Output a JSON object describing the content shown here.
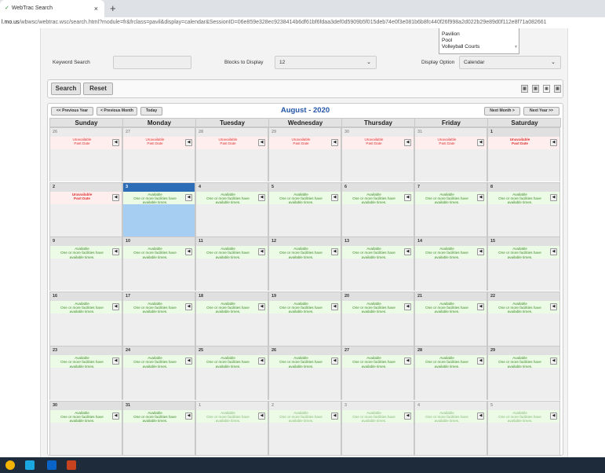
{
  "browser": {
    "tab_title": "WebTrac Search",
    "tab_close": "×",
    "new_tab": "+",
    "url_host": "l.mo.us",
    "url_rest": "/wbwsc/webtrac.wsc/search.html?module=fr&frclass=pavil&display=calendar&SessionID=06e859e328ec9238414b6df61bf6fdaa3def0d5909b5f015deb74e0f3e081b6b8fc440f26f998a2d022b29e89d0f112e8f71a082661"
  },
  "facilities": [
    "Pavilion",
    "Pool",
    "Volleyball Courts"
  ],
  "filters": {
    "keyword_label": "Keyword Search",
    "keyword_value": "",
    "blocks_label": "Blocks to Display",
    "blocks_value": "12",
    "display_label": "Display Option",
    "display_value": "Calendar"
  },
  "buttons": {
    "search": "Search",
    "reset": "Reset"
  },
  "calendar": {
    "prev_year": "<< Previous Year",
    "prev_month": "< Previous Month",
    "today": "Today",
    "title": "August - 2020",
    "next_month": "Next Month >",
    "next_year": "Next Year >>",
    "days": [
      "Sunday",
      "Monday",
      "Tuesday",
      "Wednesday",
      "Thursday",
      "Friday",
      "Saturday"
    ],
    "unavailable_line1": "Unavailable",
    "unavailable_line2": "Past Date",
    "available_line1": "Available",
    "available_line2": "One or more facilities have",
    "available_line3": "available times.",
    "weeks": [
      [
        {
          "d": "26",
          "s": "unav",
          "o": true
        },
        {
          "d": "27",
          "s": "unav",
          "o": true
        },
        {
          "d": "28",
          "s": "unav",
          "o": true
        },
        {
          "d": "29",
          "s": "unav",
          "o": true
        },
        {
          "d": "30",
          "s": "unav",
          "o": true
        },
        {
          "d": "31",
          "s": "unav",
          "o": true
        },
        {
          "d": "1",
          "s": "unav",
          "o": false,
          "b": true
        }
      ],
      [
        {
          "d": "2",
          "s": "unav",
          "o": false,
          "b": true
        },
        {
          "d": "3",
          "s": "av",
          "o": false,
          "t": true
        },
        {
          "d": "4",
          "s": "av",
          "o": false
        },
        {
          "d": "5",
          "s": "av",
          "o": false
        },
        {
          "d": "6",
          "s": "av",
          "o": false
        },
        {
          "d": "7",
          "s": "av",
          "o": false
        },
        {
          "d": "8",
          "s": "av",
          "o": false
        }
      ],
      [
        {
          "d": "9",
          "s": "av",
          "o": false
        },
        {
          "d": "10",
          "s": "av",
          "o": false
        },
        {
          "d": "11",
          "s": "av",
          "o": false
        },
        {
          "d": "12",
          "s": "av",
          "o": false
        },
        {
          "d": "13",
          "s": "av",
          "o": false
        },
        {
          "d": "14",
          "s": "av",
          "o": false
        },
        {
          "d": "15",
          "s": "av",
          "o": false
        }
      ],
      [
        {
          "d": "16",
          "s": "av",
          "o": false
        },
        {
          "d": "17",
          "s": "av",
          "o": false
        },
        {
          "d": "18",
          "s": "av",
          "o": false
        },
        {
          "d": "19",
          "s": "av",
          "o": false
        },
        {
          "d": "20",
          "s": "av",
          "o": false
        },
        {
          "d": "21",
          "s": "av",
          "o": false
        },
        {
          "d": "22",
          "s": "av",
          "o": false
        }
      ],
      [
        {
          "d": "23",
          "s": "av",
          "o": false
        },
        {
          "d": "24",
          "s": "av",
          "o": false
        },
        {
          "d": "25",
          "s": "av",
          "o": false
        },
        {
          "d": "26",
          "s": "av",
          "o": false
        },
        {
          "d": "27",
          "s": "av",
          "o": false
        },
        {
          "d": "28",
          "s": "av",
          "o": false
        },
        {
          "d": "29",
          "s": "av",
          "o": false
        }
      ],
      [
        {
          "d": "30",
          "s": "av",
          "o": false
        },
        {
          "d": "31",
          "s": "av",
          "o": false
        },
        {
          "d": "1",
          "s": "av",
          "o": true
        },
        {
          "d": "2",
          "s": "av",
          "o": true
        },
        {
          "d": "3",
          "s": "av",
          "o": true
        },
        {
          "d": "4",
          "s": "av",
          "o": true
        },
        {
          "d": "5",
          "s": "av",
          "o": true
        }
      ]
    ]
  },
  "icons": {
    "expand": "◀",
    "caret": "⌄"
  }
}
